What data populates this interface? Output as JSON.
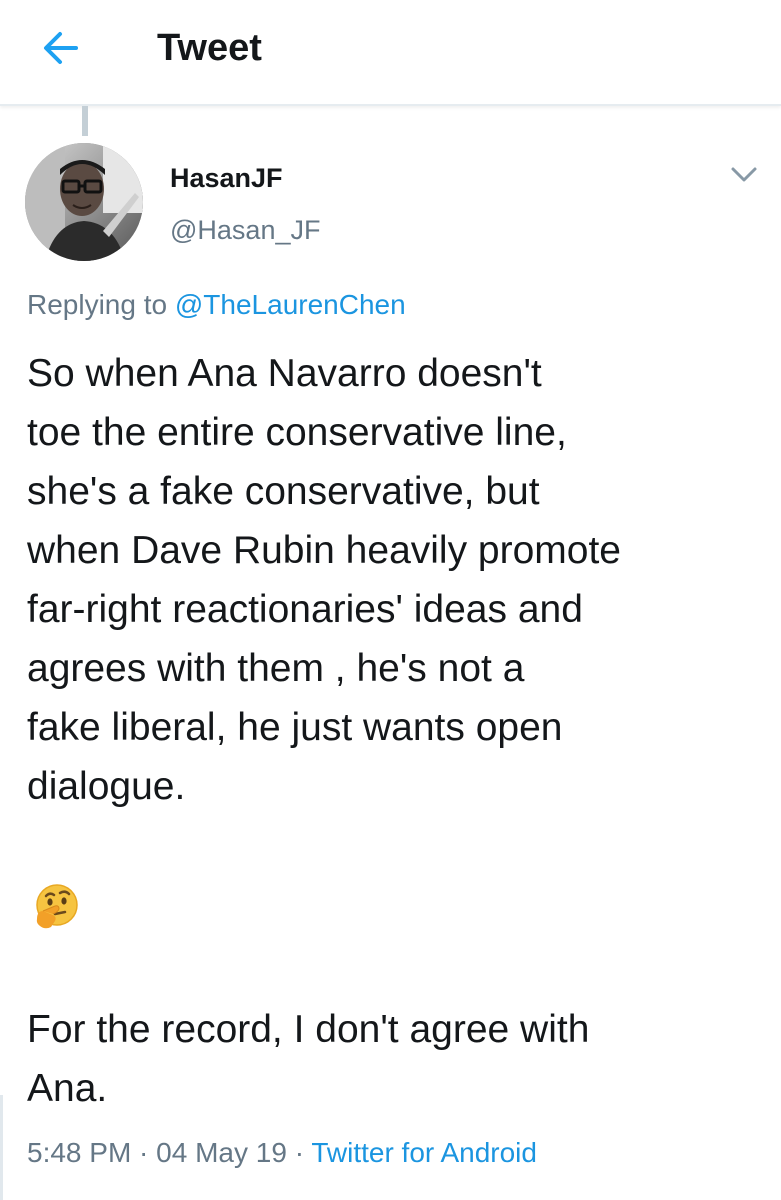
{
  "header": {
    "title": "Tweet",
    "back_icon": "arrow-left-icon",
    "accent_color": "#1da1f2"
  },
  "tweet": {
    "author": {
      "display_name": "HasanJF",
      "handle": "@Hasan_JF",
      "avatar": "profile-photo"
    },
    "menu_icon": "chevron-down-icon",
    "reply": {
      "prefix": "Replying to ",
      "target": "@TheLaurenChen"
    },
    "text_main": "So when Ana Navarro doesn't\ntoe the entire conservative line,\nshe's a fake conservative, but\nwhen Dave Rubin heavily promote\nfar-right reactionaries' ideas and\nagrees with them , he's not a\nfake liberal, he just wants open\ndialogue.",
    "emoji": "thinking-face-emoji",
    "text_after": "For the record, I don't agree with\nAna.",
    "time": "5:48 PM",
    "sep1": " · ",
    "date": "04 May 19",
    "sep2": " · ",
    "source": "Twitter for Android",
    "link_color": "#1b95e0",
    "muted_color": "#657786"
  }
}
